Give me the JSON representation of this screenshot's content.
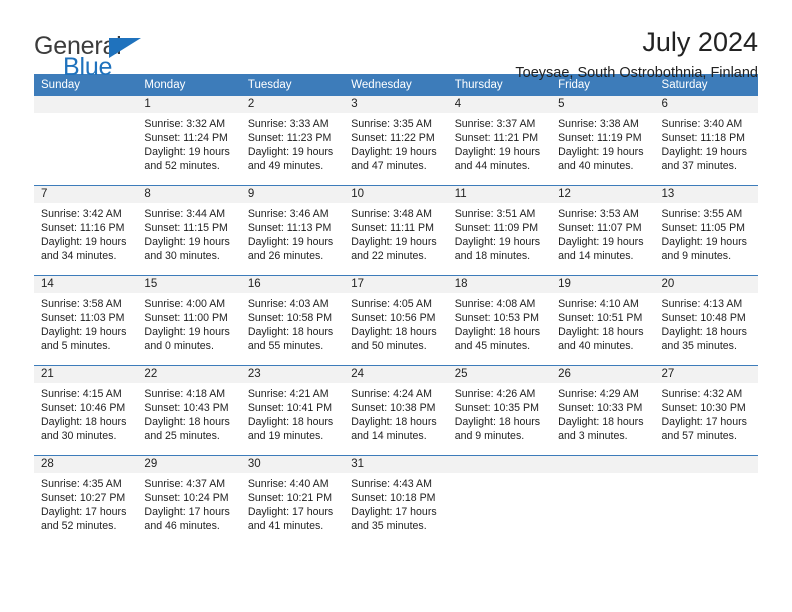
{
  "brand": {
    "word1": "General",
    "word2": "Blue",
    "triangle_color": "#1f72bd"
  },
  "header": {
    "title": "July 2024",
    "subtitle": "Toeysae, South Ostrobothnia, Finland"
  },
  "calendar": {
    "accent_color": "#3d7cba",
    "daynum_bg": "#f2f2f2",
    "weekdays": [
      "Sunday",
      "Monday",
      "Tuesday",
      "Wednesday",
      "Thursday",
      "Friday",
      "Saturday"
    ],
    "weeks": [
      [
        {
          "day": ""
        },
        {
          "day": "1",
          "sunrise": "Sunrise: 3:32 AM",
          "sunset": "Sunset: 11:24 PM",
          "daylight1": "Daylight: 19 hours",
          "daylight2": "and 52 minutes."
        },
        {
          "day": "2",
          "sunrise": "Sunrise: 3:33 AM",
          "sunset": "Sunset: 11:23 PM",
          "daylight1": "Daylight: 19 hours",
          "daylight2": "and 49 minutes."
        },
        {
          "day": "3",
          "sunrise": "Sunrise: 3:35 AM",
          "sunset": "Sunset: 11:22 PM",
          "daylight1": "Daylight: 19 hours",
          "daylight2": "and 47 minutes."
        },
        {
          "day": "4",
          "sunrise": "Sunrise: 3:37 AM",
          "sunset": "Sunset: 11:21 PM",
          "daylight1": "Daylight: 19 hours",
          "daylight2": "and 44 minutes."
        },
        {
          "day": "5",
          "sunrise": "Sunrise: 3:38 AM",
          "sunset": "Sunset: 11:19 PM",
          "daylight1": "Daylight: 19 hours",
          "daylight2": "and 40 minutes."
        },
        {
          "day": "6",
          "sunrise": "Sunrise: 3:40 AM",
          "sunset": "Sunset: 11:18 PM",
          "daylight1": "Daylight: 19 hours",
          "daylight2": "and 37 minutes."
        }
      ],
      [
        {
          "day": "7",
          "sunrise": "Sunrise: 3:42 AM",
          "sunset": "Sunset: 11:16 PM",
          "daylight1": "Daylight: 19 hours",
          "daylight2": "and 34 minutes."
        },
        {
          "day": "8",
          "sunrise": "Sunrise: 3:44 AM",
          "sunset": "Sunset: 11:15 PM",
          "daylight1": "Daylight: 19 hours",
          "daylight2": "and 30 minutes."
        },
        {
          "day": "9",
          "sunrise": "Sunrise: 3:46 AM",
          "sunset": "Sunset: 11:13 PM",
          "daylight1": "Daylight: 19 hours",
          "daylight2": "and 26 minutes."
        },
        {
          "day": "10",
          "sunrise": "Sunrise: 3:48 AM",
          "sunset": "Sunset: 11:11 PM",
          "daylight1": "Daylight: 19 hours",
          "daylight2": "and 22 minutes."
        },
        {
          "day": "11",
          "sunrise": "Sunrise: 3:51 AM",
          "sunset": "Sunset: 11:09 PM",
          "daylight1": "Daylight: 19 hours",
          "daylight2": "and 18 minutes."
        },
        {
          "day": "12",
          "sunrise": "Sunrise: 3:53 AM",
          "sunset": "Sunset: 11:07 PM",
          "daylight1": "Daylight: 19 hours",
          "daylight2": "and 14 minutes."
        },
        {
          "day": "13",
          "sunrise": "Sunrise: 3:55 AM",
          "sunset": "Sunset: 11:05 PM",
          "daylight1": "Daylight: 19 hours",
          "daylight2": "and 9 minutes."
        }
      ],
      [
        {
          "day": "14",
          "sunrise": "Sunrise: 3:58 AM",
          "sunset": "Sunset: 11:03 PM",
          "daylight1": "Daylight: 19 hours",
          "daylight2": "and 5 minutes."
        },
        {
          "day": "15",
          "sunrise": "Sunrise: 4:00 AM",
          "sunset": "Sunset: 11:00 PM",
          "daylight1": "Daylight: 19 hours",
          "daylight2": "and 0 minutes."
        },
        {
          "day": "16",
          "sunrise": "Sunrise: 4:03 AM",
          "sunset": "Sunset: 10:58 PM",
          "daylight1": "Daylight: 18 hours",
          "daylight2": "and 55 minutes."
        },
        {
          "day": "17",
          "sunrise": "Sunrise: 4:05 AM",
          "sunset": "Sunset: 10:56 PM",
          "daylight1": "Daylight: 18 hours",
          "daylight2": "and 50 minutes."
        },
        {
          "day": "18",
          "sunrise": "Sunrise: 4:08 AM",
          "sunset": "Sunset: 10:53 PM",
          "daylight1": "Daylight: 18 hours",
          "daylight2": "and 45 minutes."
        },
        {
          "day": "19",
          "sunrise": "Sunrise: 4:10 AM",
          "sunset": "Sunset: 10:51 PM",
          "daylight1": "Daylight: 18 hours",
          "daylight2": "and 40 minutes."
        },
        {
          "day": "20",
          "sunrise": "Sunrise: 4:13 AM",
          "sunset": "Sunset: 10:48 PM",
          "daylight1": "Daylight: 18 hours",
          "daylight2": "and 35 minutes."
        }
      ],
      [
        {
          "day": "21",
          "sunrise": "Sunrise: 4:15 AM",
          "sunset": "Sunset: 10:46 PM",
          "daylight1": "Daylight: 18 hours",
          "daylight2": "and 30 minutes."
        },
        {
          "day": "22",
          "sunrise": "Sunrise: 4:18 AM",
          "sunset": "Sunset: 10:43 PM",
          "daylight1": "Daylight: 18 hours",
          "daylight2": "and 25 minutes."
        },
        {
          "day": "23",
          "sunrise": "Sunrise: 4:21 AM",
          "sunset": "Sunset: 10:41 PM",
          "daylight1": "Daylight: 18 hours",
          "daylight2": "and 19 minutes."
        },
        {
          "day": "24",
          "sunrise": "Sunrise: 4:24 AM",
          "sunset": "Sunset: 10:38 PM",
          "daylight1": "Daylight: 18 hours",
          "daylight2": "and 14 minutes."
        },
        {
          "day": "25",
          "sunrise": "Sunrise: 4:26 AM",
          "sunset": "Sunset: 10:35 PM",
          "daylight1": "Daylight: 18 hours",
          "daylight2": "and 9 minutes."
        },
        {
          "day": "26",
          "sunrise": "Sunrise: 4:29 AM",
          "sunset": "Sunset: 10:33 PM",
          "daylight1": "Daylight: 18 hours",
          "daylight2": "and 3 minutes."
        },
        {
          "day": "27",
          "sunrise": "Sunrise: 4:32 AM",
          "sunset": "Sunset: 10:30 PM",
          "daylight1": "Daylight: 17 hours",
          "daylight2": "and 57 minutes."
        }
      ],
      [
        {
          "day": "28",
          "sunrise": "Sunrise: 4:35 AM",
          "sunset": "Sunset: 10:27 PM",
          "daylight1": "Daylight: 17 hours",
          "daylight2": "and 52 minutes."
        },
        {
          "day": "29",
          "sunrise": "Sunrise: 4:37 AM",
          "sunset": "Sunset: 10:24 PM",
          "daylight1": "Daylight: 17 hours",
          "daylight2": "and 46 minutes."
        },
        {
          "day": "30",
          "sunrise": "Sunrise: 4:40 AM",
          "sunset": "Sunset: 10:21 PM",
          "daylight1": "Daylight: 17 hours",
          "daylight2": "and 41 minutes."
        },
        {
          "day": "31",
          "sunrise": "Sunrise: 4:43 AM",
          "sunset": "Sunset: 10:18 PM",
          "daylight1": "Daylight: 17 hours",
          "daylight2": "and 35 minutes."
        },
        {
          "day": ""
        },
        {
          "day": ""
        },
        {
          "day": ""
        }
      ]
    ]
  }
}
